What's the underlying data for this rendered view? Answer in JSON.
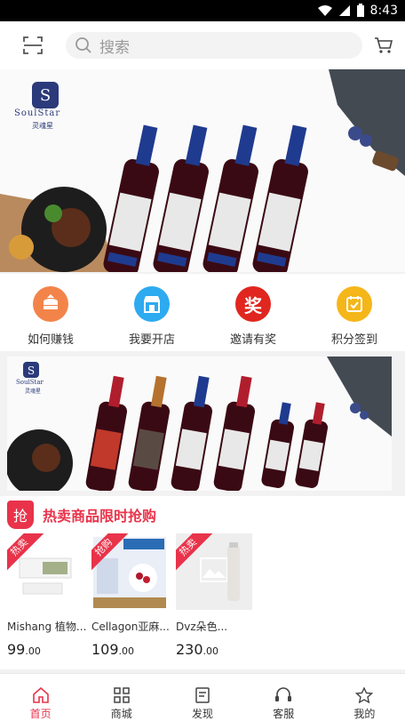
{
  "status": {
    "time": "8:43"
  },
  "search": {
    "placeholder": "搜索"
  },
  "banner1": {
    "brand": "SoulStar",
    "brand_sub": "灵魂星"
  },
  "banner2": {
    "brand": "SoulStar",
    "brand_sub": "灵魂星"
  },
  "quick_actions": [
    {
      "label": "如何赚钱",
      "icon": "coin-stack-icon",
      "color": "#f2844a"
    },
    {
      "label": "我要开店",
      "icon": "shop-icon",
      "color": "#2eaaf0"
    },
    {
      "label": "邀请有奖",
      "icon": "reward-icon",
      "color": "#e0261f",
      "glyph": "奖"
    },
    {
      "label": "积分签到",
      "icon": "calendar-check-icon",
      "color": "#f5b619"
    }
  ],
  "flash_sale": {
    "badge": "抢",
    "title": "热卖商品限时抢购",
    "products": [
      {
        "ribbon": "热卖",
        "name": "Mishang 植物...",
        "price_int": "99",
        "price_dec": ".00"
      },
      {
        "ribbon": "抢购",
        "name": "Cellagon亚麻...",
        "price_int": "109",
        "price_dec": ".00"
      },
      {
        "ribbon": "热卖",
        "name": "Dvz朵色...",
        "price_int": "230",
        "price_dec": ".00"
      }
    ]
  },
  "tabbar": [
    {
      "label": "首页",
      "icon": "home-icon",
      "active": true
    },
    {
      "label": "商城",
      "icon": "grid-icon",
      "active": false
    },
    {
      "label": "发现",
      "icon": "discover-icon",
      "active": false
    },
    {
      "label": "客服",
      "icon": "headset-icon",
      "active": false
    },
    {
      "label": "我的",
      "icon": "star-icon",
      "active": false
    }
  ]
}
